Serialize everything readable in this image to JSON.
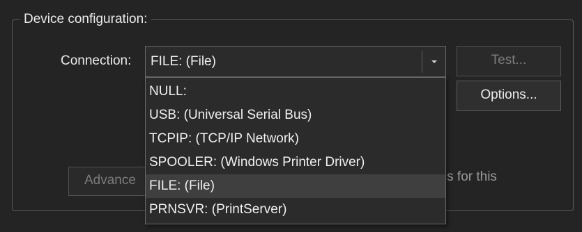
{
  "group": {
    "title": "Device configuration:"
  },
  "connection": {
    "label": "Connection:",
    "selected": "FILE: (File)",
    "options": [
      "NULL:",
      "USB: (Universal Serial Bus)",
      "TCPIP: (TCP/IP Network)",
      "SPOOLER: (Windows Printer Driver)",
      "FILE: (File)",
      "PRNSVR: (PrintServer)"
    ]
  },
  "buttons": {
    "test": "Test...",
    "options": "Options...",
    "advanced": "Advance"
  },
  "background_text": "ons for this",
  "icons": {
    "dropdown_arrow": "chevron-down-icon"
  }
}
